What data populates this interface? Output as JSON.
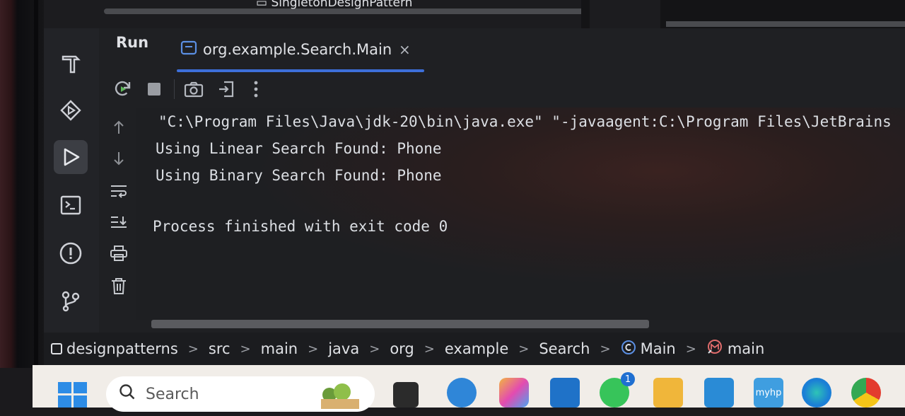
{
  "top": {
    "file_partial": "SingletonDesignPattern"
  },
  "run_panel": {
    "run_label": "Run",
    "tab_title": "org.example.Search.Main",
    "close_glyph": "×"
  },
  "console": {
    "lines": [
      "\"C:\\Program Files\\Java\\jdk-20\\bin\\java.exe\" \"-javaagent:C:\\Program Files\\JetBrains",
      "Using Linear Search Found: Phone",
      "Using Binary Search Found: Phone",
      "Process finished with exit code 0"
    ]
  },
  "breadcrumb": {
    "items": [
      "designpatterns",
      "src",
      "main",
      "java",
      "org",
      "example",
      "Search",
      "Main",
      "main"
    ],
    "separator": ">"
  },
  "taskbar": {
    "search_placeholder": "Search",
    "whatsapp_badge": "1",
    "hp_label": "myhp"
  },
  "colors": {
    "accent": "#3d6fd9",
    "console_bg": "#1e1f22",
    "taskbar_bg": "#f1ede8"
  }
}
